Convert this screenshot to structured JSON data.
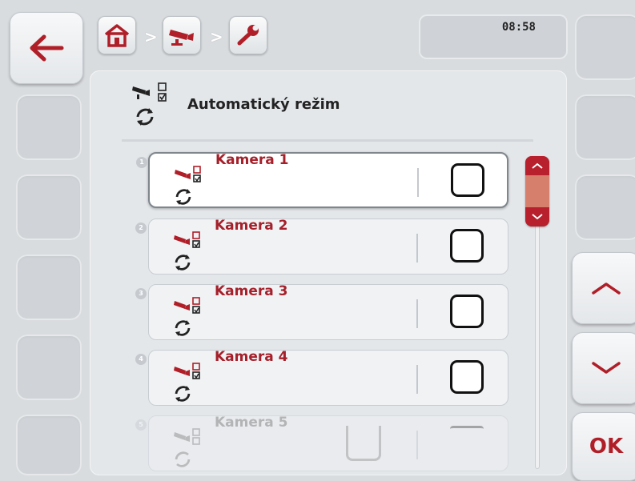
{
  "header": {
    "time": "08:58",
    "breadcrumb": [
      {
        "icon": "home-icon"
      },
      {
        "icon": "camera-icon"
      },
      {
        "icon": "wrench-icon"
      }
    ],
    "separator": ">"
  },
  "title": "Automatický režim",
  "list": [
    {
      "num": "1",
      "label": "Kamera 1",
      "checked": false,
      "selected": true
    },
    {
      "num": "2",
      "label": "Kamera 2",
      "checked": false,
      "selected": false
    },
    {
      "num": "3",
      "label": "Kamera 3",
      "checked": false,
      "selected": false
    },
    {
      "num": "4",
      "label": "Kamera 4",
      "checked": false,
      "selected": false
    },
    {
      "num": "5",
      "label": "Kamera 5",
      "checked": false,
      "selected": false
    }
  ],
  "right": {
    "ok_label": "OK"
  },
  "colors": {
    "accent": "#b01e28",
    "label": "#a5202a"
  }
}
